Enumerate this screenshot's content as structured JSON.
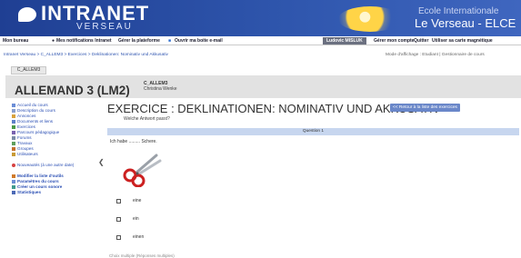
{
  "header": {
    "brand": "INTRANET",
    "brand_sub": "VERSEAU",
    "school_line1": "Ecole Internationale",
    "school_line2": "Le Verseau - ELCE",
    "colors": {
      "primary": "#2f56ad",
      "title_band": "#e2e2e2",
      "question_bar": "#c7d6ef",
      "button": "#6a87c9"
    }
  },
  "topbar": {
    "office": "Mon bureau",
    "notifications": "Mes notifications Intranet",
    "manage": "Gérer la plateforme",
    "mailbox": "Ouvrir ma boite e-mail",
    "user": "Ludovic MISLUK",
    "account": "Gérer mon compte",
    "quit": "Quitter",
    "card": "Utiliser sa carte magnétique"
  },
  "breadcrumb": "Intranet Verseau > C_ALLEM3 > Exercices > Deklinationen: Nominativ und Akkusativ",
  "display_mode": "Mode d'affichage : Etudiant | Gestionnaire de cours",
  "tab_label": "C_ALLEM3",
  "course": {
    "title": "ALLEMAND 3 (LM2)",
    "code": "C_ALLEM3",
    "teacher": "Christina Wenke"
  },
  "nav": [
    {
      "label": "Accueil du cours",
      "icon": "home-icon"
    },
    {
      "label": "Description du cours",
      "icon": "description-icon"
    },
    {
      "label": "Annonces",
      "icon": "announcement-icon"
    },
    {
      "label": "Documents et liens",
      "icon": "documents-icon"
    },
    {
      "label": "Exercices",
      "icon": "exercise-icon"
    },
    {
      "label": "Parcours pédagogique",
      "icon": "path-icon"
    },
    {
      "label": "Forums",
      "icon": "forum-icon"
    },
    {
      "label": "Travaux",
      "icon": "work-icon"
    },
    {
      "label": "Groupes",
      "icon": "groups-icon"
    },
    {
      "label": "Utilisateurs",
      "icon": "users-icon"
    },
    {
      "label": "Nouveautés (à une autre date)",
      "icon": "star-icon"
    },
    {
      "label": "Modifier la liste d'outils",
      "icon": "edit-icon"
    },
    {
      "label": "Paramètres du cours",
      "icon": "settings-icon"
    },
    {
      "label": "Créer un cours sonore",
      "icon": "sound-icon"
    },
    {
      "label": "Statistiques",
      "icon": "stats-icon"
    }
  ],
  "exercise": {
    "title": "EXERCICE : DEKLINATIONEN: NOMINATIV UND AKKUSATIV",
    "back_button": "<< Retour à la liste des exercices",
    "description": "Welche Antwort passt?",
    "question_header": "Question 1",
    "prompt": "Ich habe ......... Schere.",
    "image_icon": "scissors-icon",
    "options": [
      "eine",
      "ein",
      "einen"
    ],
    "footer": "Choix multiple (Réponses multiples)"
  }
}
